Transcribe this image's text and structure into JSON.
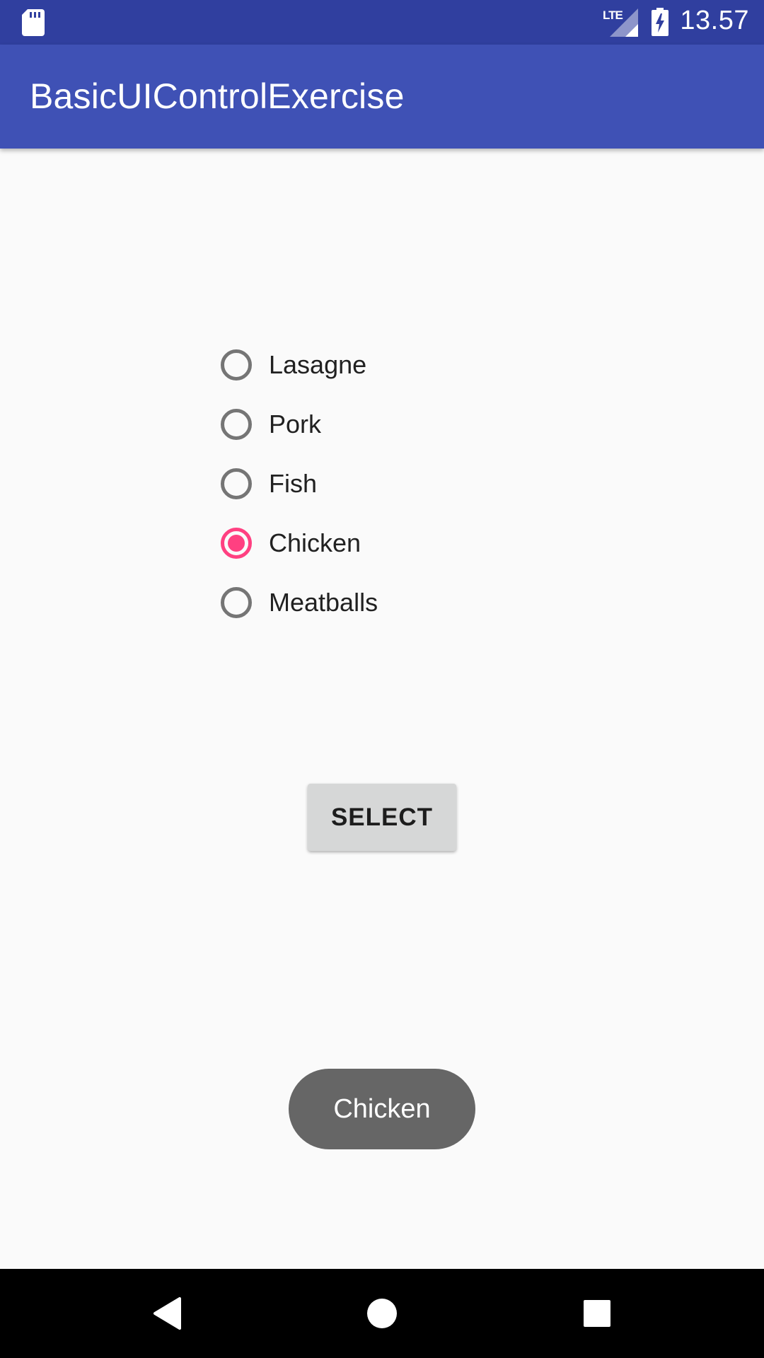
{
  "status_bar": {
    "network_label": "LTE",
    "time": "13.57",
    "icons": [
      "sd-card-icon",
      "signal-icon",
      "battery-charging-icon"
    ]
  },
  "app_bar": {
    "title": "BasicUIControlExercise"
  },
  "radio_group": {
    "options": [
      {
        "label": "Lasagne",
        "checked": false
      },
      {
        "label": "Pork",
        "checked": false
      },
      {
        "label": "Fish",
        "checked": false
      },
      {
        "label": "Chicken",
        "checked": true
      },
      {
        "label": "Meatballs",
        "checked": false
      }
    ]
  },
  "select_button": {
    "label": "SELECT"
  },
  "toast": {
    "message": "Chicken"
  },
  "nav_bar": {
    "icons": [
      "back-icon",
      "home-icon",
      "recents-icon"
    ]
  },
  "colors": {
    "status_bar": "#303f9f",
    "app_bar": "#3f51b5",
    "accent": "#ff4081",
    "radio_unchecked": "#757575",
    "button": "#d6d7d7",
    "toast": "#666666",
    "background": "#fafafa"
  }
}
